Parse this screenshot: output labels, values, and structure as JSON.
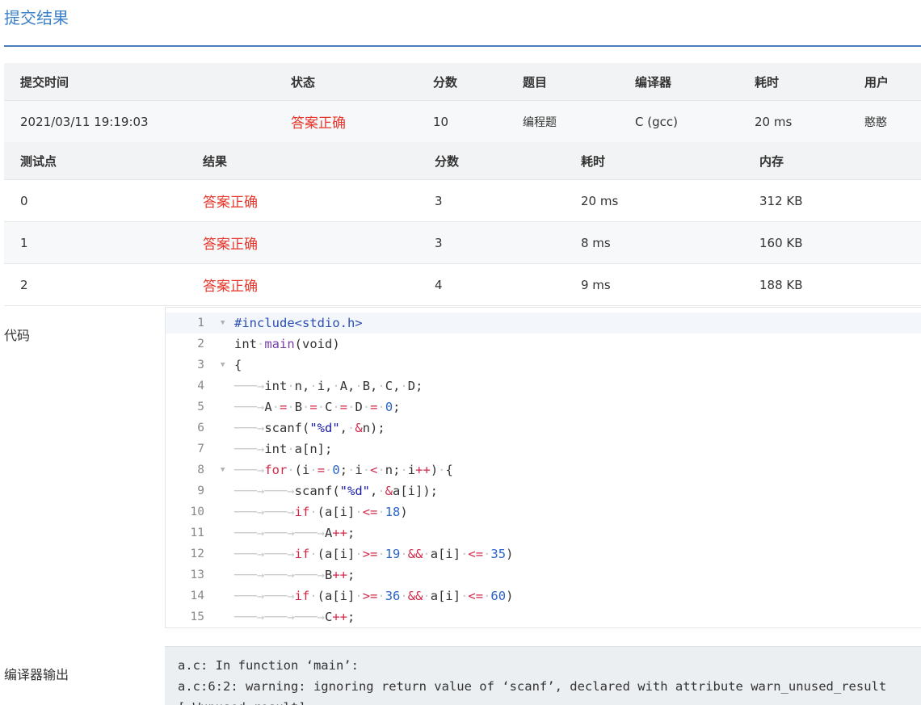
{
  "page": {
    "title": "提交结果"
  },
  "submission": {
    "headers": [
      "提交时间",
      "状态",
      "分数",
      "题目",
      "编译器",
      "耗时",
      "用户"
    ],
    "row": {
      "time": "2021/03/11 19:19:03",
      "status": "答案正确",
      "score": "10",
      "problem": "编程题",
      "compiler": "C (gcc)",
      "duration": "20 ms",
      "user": "憨憨"
    }
  },
  "testcases": {
    "headers": [
      "测试点",
      "结果",
      "分数",
      "耗时",
      "内存"
    ],
    "rows": [
      {
        "id": "0",
        "result": "答案正确",
        "score": "3",
        "time": "20 ms",
        "memory": "312 KB"
      },
      {
        "id": "1",
        "result": "答案正确",
        "score": "3",
        "time": "8 ms",
        "memory": "160 KB"
      },
      {
        "id": "2",
        "result": "答案正确",
        "score": "4",
        "time": "9 ms",
        "memory": "188 KB"
      }
    ]
  },
  "code": {
    "label": "代码",
    "lines": [
      {
        "n": "1",
        "fold": true,
        "text": "#include<stdio.h>"
      },
      {
        "n": "2",
        "fold": false,
        "text": "int main(void)"
      },
      {
        "n": "3",
        "fold": true,
        "text": "{"
      },
      {
        "n": "4",
        "fold": false,
        "text": "    int n, i, A, B, C, D;"
      },
      {
        "n": "5",
        "fold": false,
        "text": "    A = B = C = D = 0;"
      },
      {
        "n": "6",
        "fold": false,
        "text": "    scanf(\"%d\", &n);"
      },
      {
        "n": "7",
        "fold": false,
        "text": "    int a[n];"
      },
      {
        "n": "8",
        "fold": true,
        "text": "    for (i = 0; i < n; i++) {"
      },
      {
        "n": "9",
        "fold": false,
        "text": "        scanf(\"%d\", &a[i]);"
      },
      {
        "n": "10",
        "fold": false,
        "text": "        if (a[i] <= 18)"
      },
      {
        "n": "11",
        "fold": false,
        "text": "            A++;"
      },
      {
        "n": "12",
        "fold": false,
        "text": "        if (a[i] >= 19 && a[i] <= 35)"
      },
      {
        "n": "13",
        "fold": false,
        "text": "            B++;"
      },
      {
        "n": "14",
        "fold": false,
        "text": "        if (a[i] >= 36 && a[i] <= 60)"
      },
      {
        "n": "15",
        "fold": false,
        "text": "            C++;"
      }
    ]
  },
  "compiler_output": {
    "label": "编译器输出",
    "text": "a.c: In function ‘main’:\na.c:6:2: warning: ignoring return value of ‘scanf’, declared with attribute warn_unused_result\n[-Wunused-result]"
  }
}
